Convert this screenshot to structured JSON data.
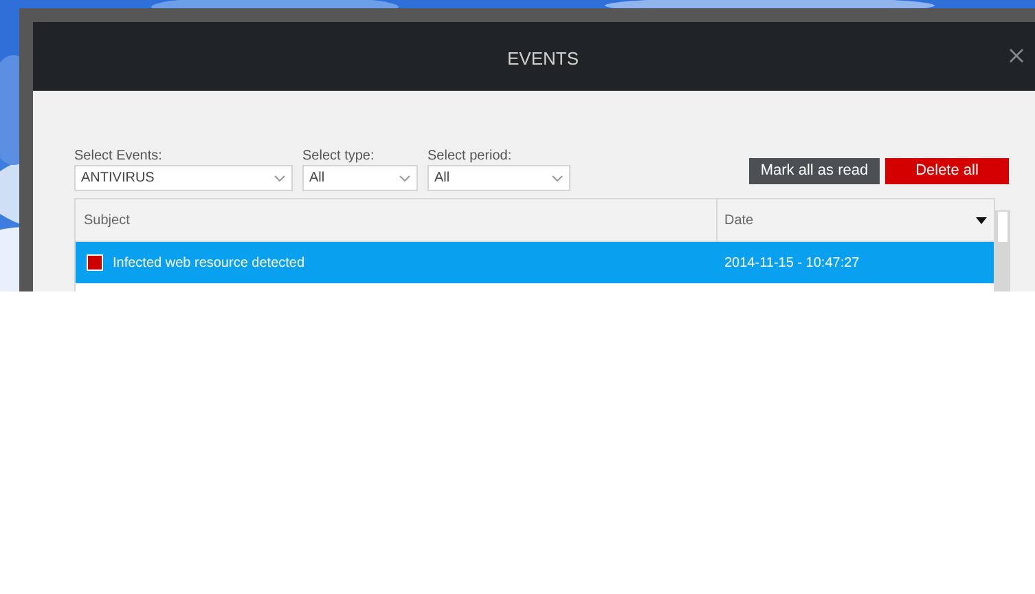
{
  "dialog": {
    "title": "EVENTS"
  },
  "filters": [
    {
      "label": "Select Events:",
      "value": "ANTIVIRUS"
    },
    {
      "label": "Select type:",
      "value": "All"
    },
    {
      "label": "Select period:",
      "value": "All"
    }
  ],
  "buttons": [
    {
      "label": "Mark all as read",
      "kind": "secondary"
    },
    {
      "label": "Delete all",
      "kind": "danger"
    }
  ],
  "table": {
    "columns": [
      "Subject",
      "Date"
    ],
    "rows": [
      {
        "subject": "Infected web resource detected",
        "date": "2014-11-15 - 10:47:27",
        "selected": true,
        "color": "#cc0000"
      }
    ]
  }
}
